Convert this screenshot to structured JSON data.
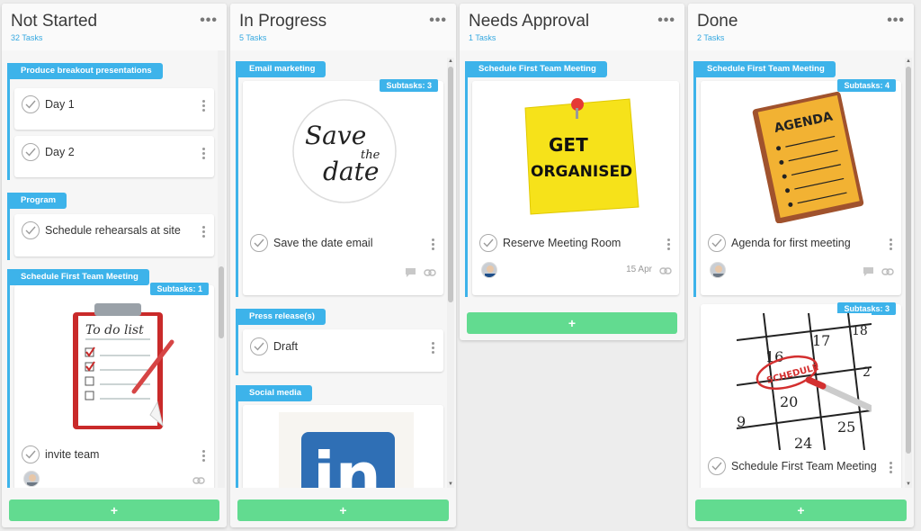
{
  "columns": [
    {
      "title": "Not Started",
      "count": "32 Tasks",
      "add_label": "+",
      "groups": [
        {
          "tag": "Produce breakout presentations",
          "tasks": [
            "Day 1",
            "Day 2"
          ]
        },
        {
          "tag": "Program",
          "tasks": [
            "Schedule rehearsals at site"
          ]
        },
        {
          "tag": "Schedule First Team Meeting",
          "subtasks": "Subtasks: 1",
          "image_text": "To do list",
          "tasks": [
            "invite team"
          ]
        }
      ]
    },
    {
      "title": "In Progress",
      "count": "5 Tasks",
      "add_label": "+",
      "groups": [
        {
          "tag": "Email marketing",
          "subtasks": "Subtasks: 3",
          "image_text": [
            "Save",
            "the",
            "date"
          ],
          "tasks": [
            "Save the date email"
          ]
        },
        {
          "tag": "Press release(s)",
          "tasks": [
            "Draft"
          ]
        },
        {
          "tag": "Social media",
          "image_text": "in",
          "tasks": []
        }
      ]
    },
    {
      "title": "Needs Approval",
      "count": "1 Tasks",
      "add_label": "+",
      "groups": [
        {
          "tag": "Schedule First Team Meeting",
          "image_text": [
            "GET",
            "ORGANISED"
          ],
          "tasks": [
            "Reserve Meeting Room"
          ],
          "date": "15 Apr"
        }
      ]
    },
    {
      "title": "Done",
      "count": "2 Tasks",
      "add_label": "+",
      "groups": [
        {
          "tag": "Schedule First Team Meeting",
          "subtasks": "Subtasks: 4",
          "image_text": "AGENDA",
          "tasks": [
            "Agenda for first meeting"
          ]
        },
        {
          "subtasks": "Subtasks: 3",
          "image_text": "SCHEDULE",
          "calendar_numbers": [
            "16",
            "17",
            "18",
            "20",
            "25",
            "24",
            "9",
            "2"
          ],
          "tasks": [
            "Schedule First Team Meeting"
          ]
        }
      ]
    }
  ],
  "colors": {
    "accent": "#3db3ea",
    "add_button": "#62db90",
    "postit": "#f6e21a",
    "agenda": "#f2b233",
    "linkedin": "#2f6fb5"
  },
  "icons": [
    "column-menu-icon",
    "check-icon",
    "kebab-icon",
    "comment-icon",
    "link-icon",
    "avatar-icon"
  ]
}
